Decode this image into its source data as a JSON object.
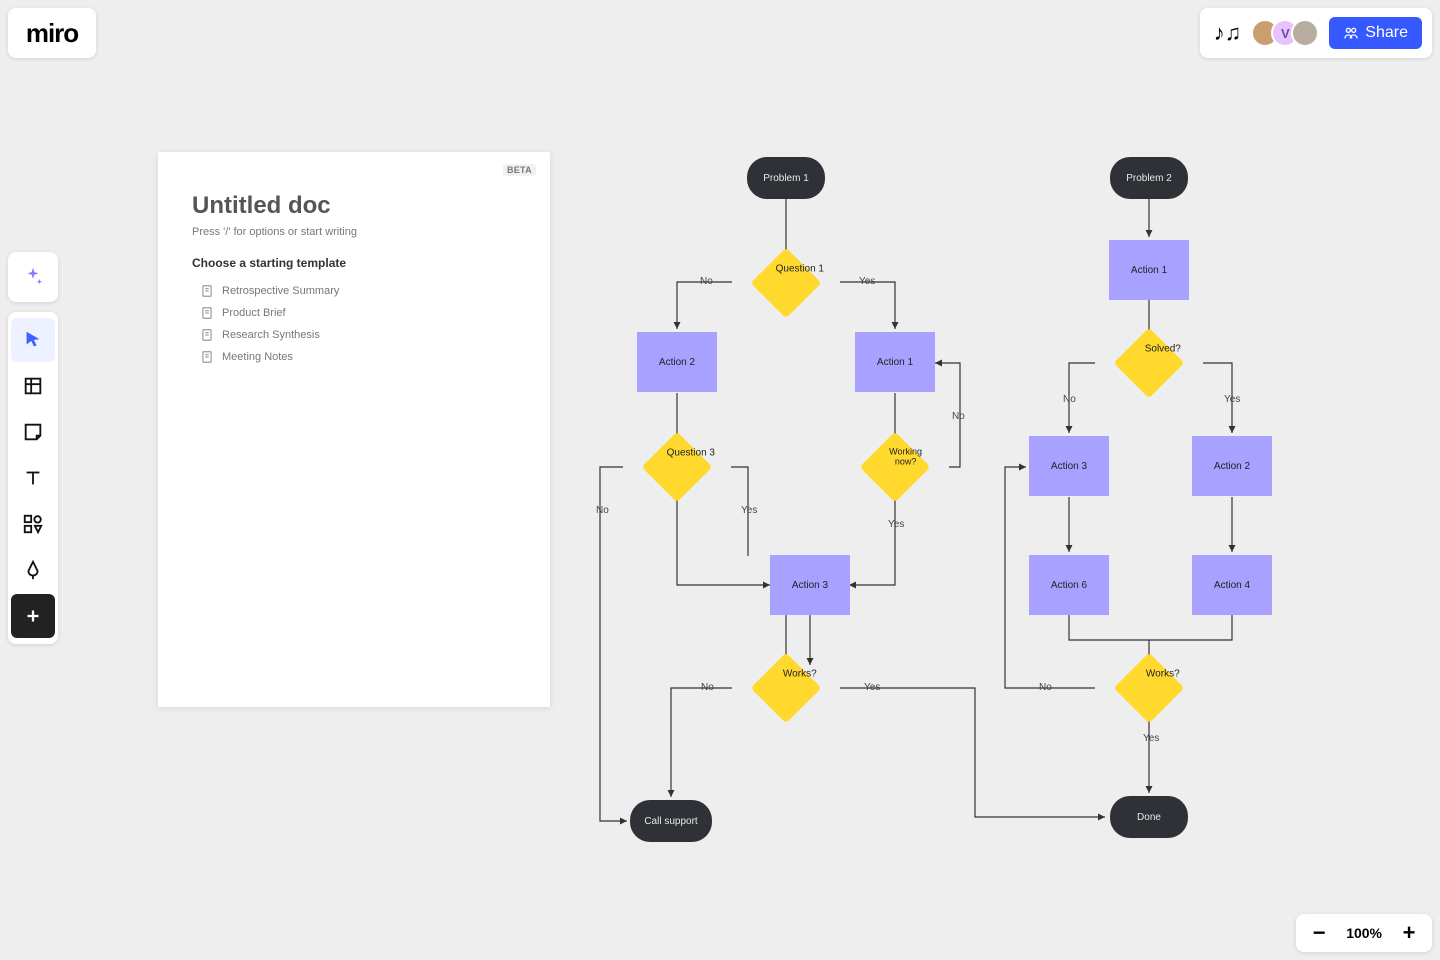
{
  "app": {
    "logo_text": "miro"
  },
  "header": {
    "share_label": "Share",
    "avatars": [
      {
        "bg": "#c89f6d",
        "label": ""
      },
      {
        "bg": "#e7c2ff",
        "label": "V",
        "text_color": "#6a4f9a"
      },
      {
        "bg": "#b8ada0",
        "label": ""
      }
    ]
  },
  "toolbar": {
    "ai_icon": "sparkle",
    "items": [
      "cursor",
      "frame",
      "sticky",
      "text",
      "shapes",
      "pen",
      "add"
    ]
  },
  "doc": {
    "beta": "BETA",
    "title": "Untitled doc",
    "hint": "Press '/' for options or start writing",
    "subhead": "Choose a starting template",
    "templates": [
      "Retrospective Summary",
      "Product Brief",
      "Research Synthesis",
      "Meeting Notes"
    ]
  },
  "flow": {
    "nodes": {
      "problem1": "Problem 1",
      "problem2": "Problem 2",
      "question1": "Question 1",
      "question3": "Question 3",
      "workingnow": "Working now?",
      "solved": "Solved?",
      "works": "Works?",
      "works2": "Works?",
      "action1": "Action 1",
      "action1b": "Action 1",
      "action2": "Action 2",
      "action2b": "Action 2",
      "action3": "Action 3",
      "action3b": "Action 3",
      "action4": "Action 4",
      "action6": "Action 6",
      "callsupport": "Call support",
      "done": "Done"
    },
    "labels": {
      "yes": "Yes",
      "no": "No"
    }
  },
  "zoom": {
    "value": "100%"
  }
}
